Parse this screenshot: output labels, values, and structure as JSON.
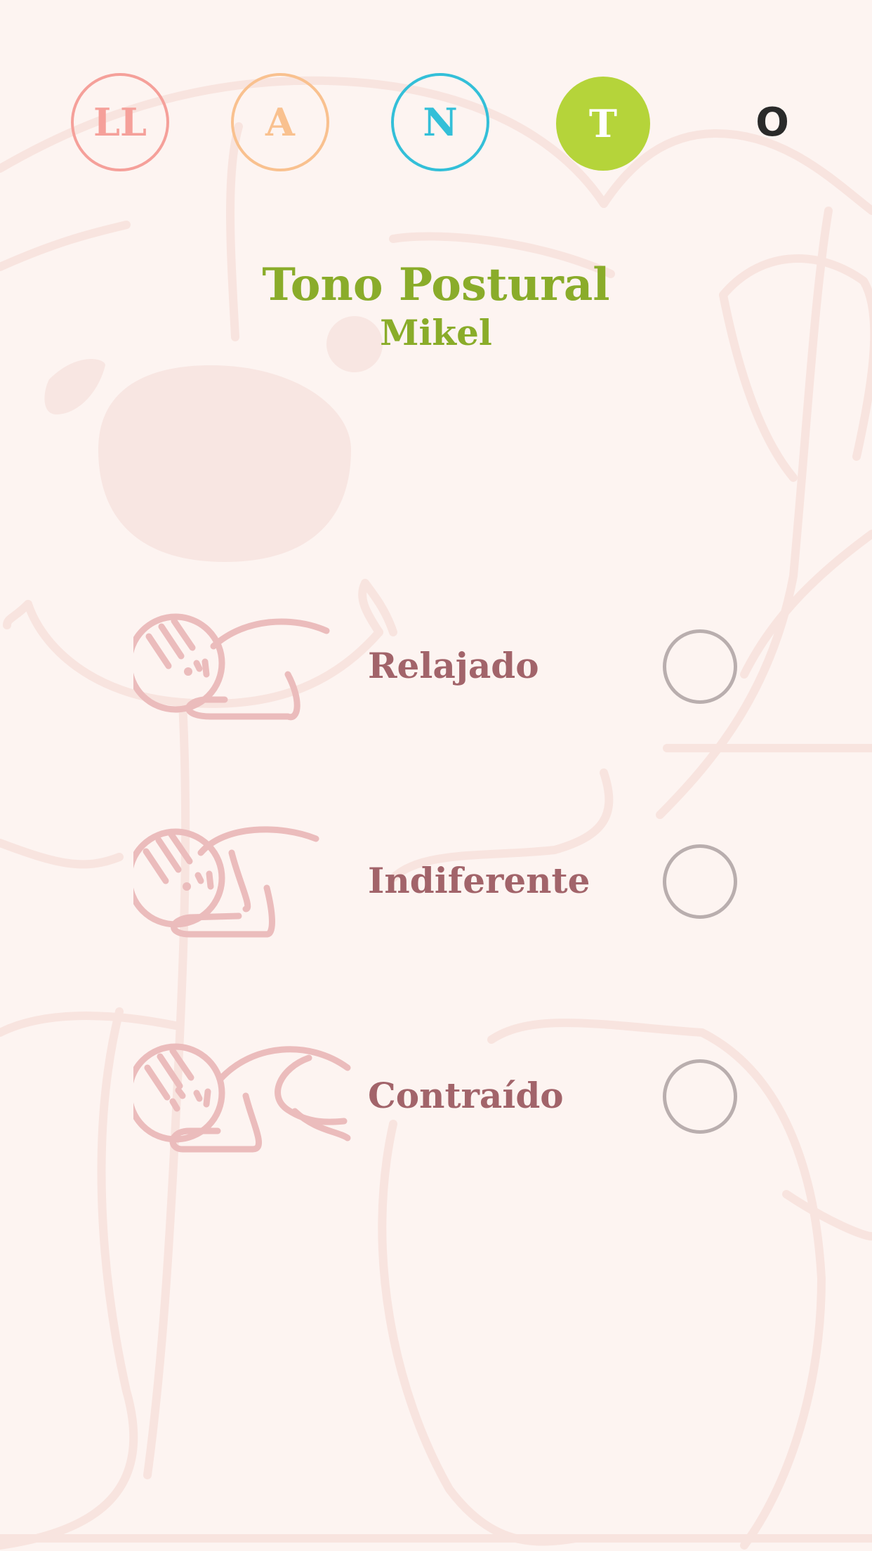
{
  "nav": {
    "tabs": [
      {
        "label": "LL"
      },
      {
        "label": "A"
      },
      {
        "label": "N"
      },
      {
        "label": "T"
      },
      {
        "label": "O"
      }
    ]
  },
  "header": {
    "title": "Tono Postural",
    "subtitle": "Mikel"
  },
  "options": [
    {
      "label": "Relajado",
      "icon": "baby-relaxed-icon",
      "selected": false
    },
    {
      "label": "Indiferente",
      "icon": "baby-indifferent-icon",
      "selected": false
    },
    {
      "label": "Contraído",
      "icon": "baby-contracted-icon",
      "selected": false
    }
  ],
  "colors": {
    "background": "#fdf4f1",
    "accent_green": "#8aac2a",
    "tab_active": "#b5d43a",
    "tab_ll": "#f5a09a",
    "tab_a": "#f9c18f",
    "tab_n": "#33bfd8",
    "option_text": "#a2646a",
    "radio_border": "#b9aeae"
  }
}
